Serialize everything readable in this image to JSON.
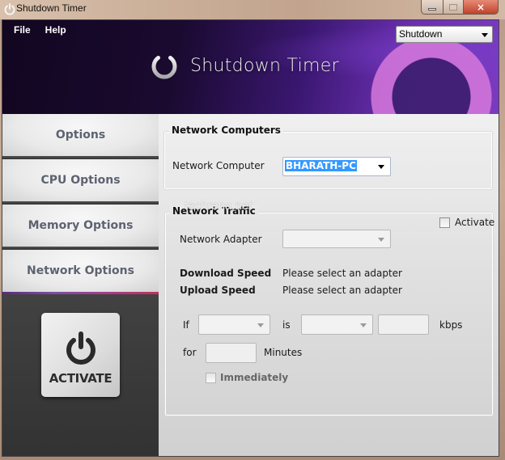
{
  "window": {
    "title": "Shutdown Timer",
    "controls": {
      "minimize": "minimize",
      "maximize": "maximize",
      "close": "×"
    }
  },
  "menu": {
    "items": [
      "File",
      "Help"
    ]
  },
  "header": {
    "logo_text": "Shutdown Timer",
    "mode_select": {
      "value": "Shutdown"
    }
  },
  "sidebar": {
    "items": [
      {
        "label": "Options"
      },
      {
        "label": "CPU Options"
      },
      {
        "label": "Memory Options"
      },
      {
        "label": "Network Options",
        "active": true
      }
    ],
    "activate_button": {
      "label": "ACTIVATE"
    }
  },
  "network_computers": {
    "title": "Network Computers",
    "computer_label": "Network Computer",
    "computer_value": "BHARATH-PC"
  },
  "network_traffic": {
    "title": "Network Traffic",
    "activate_label": "Activate",
    "activate_checked": false,
    "adapter_label": "Network Adapter",
    "adapter_value": "",
    "download_label": "Download Speed",
    "download_value": "Please select an adapter",
    "upload_label": "Upload Speed",
    "upload_value": "Please select an adapter",
    "condition": {
      "if_label": "If",
      "if_value": "",
      "is_label": "is",
      "is_value": "",
      "speed_value": "",
      "unit_label": "kbps",
      "for_label": "for",
      "minutes_value": "",
      "minutes_label": "Minutes",
      "immediately_label": "Immediately",
      "immediately_checked": false
    }
  },
  "watermark": "techrena.net"
}
